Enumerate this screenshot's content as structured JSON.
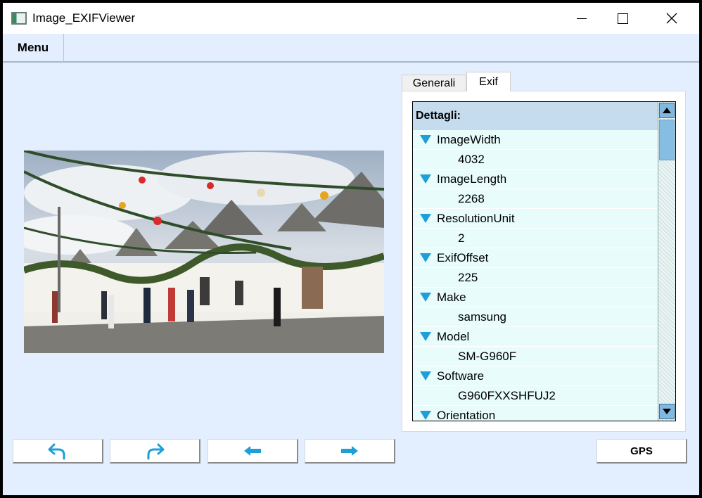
{
  "window": {
    "title": "Image_EXIFViewer"
  },
  "menu": {
    "label": "Menu"
  },
  "tabs": [
    {
      "label": "Generali"
    },
    {
      "label": "Exif"
    }
  ],
  "details": {
    "header": "Dettagli:",
    "items": [
      {
        "key": "ImageWidth",
        "value": "4032"
      },
      {
        "key": "ImageLength",
        "value": "2268"
      },
      {
        "key": "ResolutionUnit",
        "value": "2"
      },
      {
        "key": "ExifOffset",
        "value": "225"
      },
      {
        "key": "Make",
        "value": "samsung"
      },
      {
        "key": "Model",
        "value": "SM-G960F"
      },
      {
        "key": "Software",
        "value": "G960FXXSHFUJ2"
      },
      {
        "key": "Orientation",
        "value": ""
      }
    ]
  },
  "buttons": {
    "gps_label": "GPS"
  },
  "colors": {
    "accent": "#1e9fd8",
    "background": "#e3efff",
    "tree_bg": "#e8fcfc",
    "header_bg": "#c5dcee"
  },
  "icons": [
    "undo-icon",
    "redo-icon",
    "previous-arrow-icon",
    "next-arrow-icon"
  ]
}
